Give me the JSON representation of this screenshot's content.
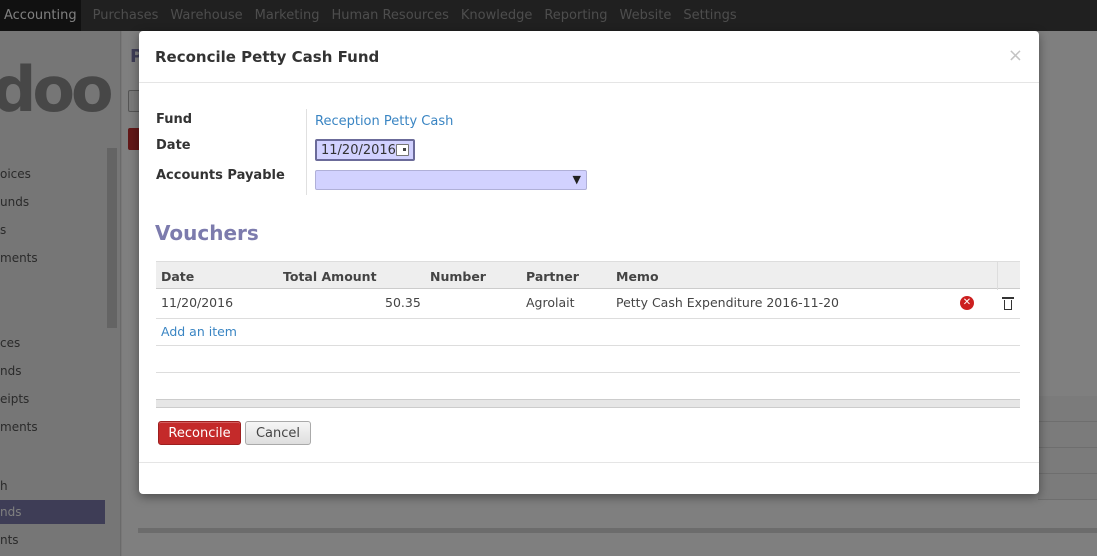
{
  "topbar": {
    "menus": [
      "Accounting",
      "Purchases",
      "Warehouse",
      "Marketing",
      "Human Resources",
      "Knowledge",
      "Reporting",
      "Website",
      "Settings"
    ]
  },
  "sidebar": {
    "logo": "doo",
    "items": [
      "oices",
      "unds",
      "s",
      "ments",
      "ces",
      "nds",
      "eipts",
      "ments",
      "h",
      "nds",
      "nts"
    ]
  },
  "background": {
    "title": "P"
  },
  "dialog": {
    "title": "Reconcile Petty Cash Fund",
    "close": "×",
    "labels": {
      "fund": "Fund",
      "date": "Date",
      "accounts_payable": "Accounts Payable"
    },
    "fund_value": "Reception Petty Cash",
    "date_value": "11/20/2016",
    "accounts_payable_value": "",
    "vouchers_title": "Vouchers",
    "columns": [
      "Date",
      "Total Amount",
      "Number",
      "Partner",
      "Memo"
    ],
    "rows": [
      {
        "date": "11/20/2016",
        "total": "50.35",
        "number": "",
        "partner": "Agrolait",
        "memo": "Petty Cash Expenditure 2016-11-20"
      }
    ],
    "add_item": "Add an item",
    "reconcile_label": "Reconcile",
    "cancel_label": "Cancel"
  }
}
